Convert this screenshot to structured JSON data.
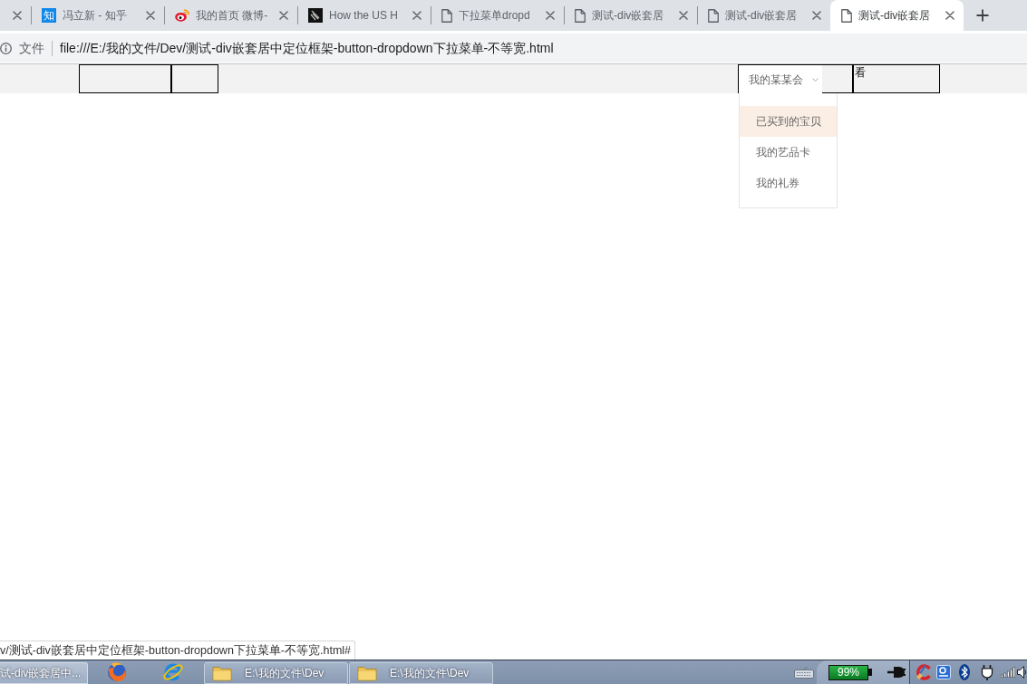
{
  "browser_tabs": [
    {
      "kind": "blank",
      "selected": false
    },
    {
      "kind": "badge",
      "badge_text": "知",
      "title": "冯立新 - 知乎",
      "selected": false
    },
    {
      "kind": "swirl",
      "title": "我的首页 微博-",
      "selected": false
    },
    {
      "kind": "tile",
      "title": "How the US H",
      "selected": false
    },
    {
      "kind": "page",
      "title": "下拉菜单dropd",
      "selected": false
    },
    {
      "kind": "page",
      "title": "测试-div嵌套居",
      "selected": false
    },
    {
      "kind": "page",
      "title": "测试-div嵌套居",
      "selected": false
    },
    {
      "kind": "page",
      "title": "测试-div嵌套居",
      "selected": true
    }
  ],
  "address_bar": {
    "scheme_label": "文件",
    "url": "file:///E:/我的文件/Dev/测试-div嵌套居中定位框架-button-dropdown下拉菜单-不等宽.html"
  },
  "page": {
    "dropdown": {
      "label": "我的某某会",
      "expanded": true,
      "items": [
        {
          "label": "已买到的宝贝",
          "selected": true
        },
        {
          "label": "我的艺品卡",
          "selected": false
        },
        {
          "label": "我的礼券",
          "selected": false
        }
      ]
    },
    "side_box_text": "看"
  },
  "status_bubble": "v/测试-div嵌套居中定位框架-button-dropdown下拉菜单-不等宽.html#",
  "taskbar": {
    "items": [
      {
        "kind": "window",
        "label": "试-div嵌套居中..."
      },
      {
        "kind": "fox"
      },
      {
        "kind": "orbit"
      },
      {
        "kind": "folder",
        "label": "E:\\我的文件\\Dev"
      },
      {
        "kind": "folder",
        "label": "E:\\我的文件\\Dev"
      }
    ],
    "battery_text": "99%"
  }
}
